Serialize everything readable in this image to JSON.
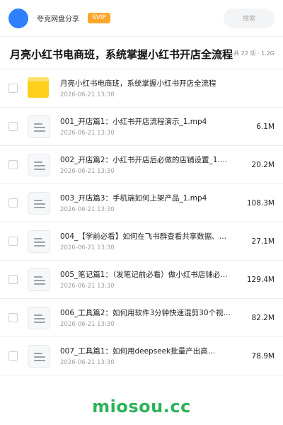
{
  "header": {
    "brand": "夸克网盘分享",
    "badge": "SVIP",
    "search_placeholder": "搜索"
  },
  "share": {
    "title": "月亮小红书电商班，系统掌握小红书开店全流程",
    "meta": "共 22 项 · 1.2G"
  },
  "files": [
    {
      "type": "folder",
      "name": "月亮小红书电商班，系统掌握小红书开店全流程",
      "date": "2026-06-21 13:30",
      "size": ""
    },
    {
      "type": "file",
      "name": "001_开店篇1：小红书开店流程演示_1.mp4",
      "date": "2026-06-21 13:30",
      "size": "6.1M"
    },
    {
      "type": "file",
      "name": "002_开店篇2：小红书开店后必做的店铺设置_1.…",
      "date": "2026-06-21 13:30",
      "size": "20.2M"
    },
    {
      "type": "file",
      "name": "003_开店篇3：手机端如何上架产品_1.mp4",
      "date": "2026-06-21 13:30",
      "size": "108.3M"
    },
    {
      "type": "file",
      "name": "004_【学前必看】如何在飞书群查看共享数据、资料…",
      "date": "2026-06-21 13:30",
      "size": "27.1M"
    },
    {
      "type": "file",
      "name": "005_笔记篇1：（发笔记前必看）做小红书店铺必须…",
      "date": "2026-06-21 13:30",
      "size": "129.4M"
    },
    {
      "type": "file",
      "name": "006_工具篇2：如何用软件3分钟快速混剪30个视…",
      "date": "2026-06-21 13:30",
      "size": "82.2M"
    },
    {
      "type": "file",
      "name": "007_工具篇1：如何用deepseek批量产出高…",
      "date": "2026-06-21 13:30",
      "size": "78.9M"
    }
  ],
  "footer": {
    "watermark": "miosou.cc"
  },
  "colors": {
    "avatar": "#2f80ff",
    "badge": "#ffa629",
    "folder": "#ffcf1a",
    "watermark": "#2db35a"
  }
}
